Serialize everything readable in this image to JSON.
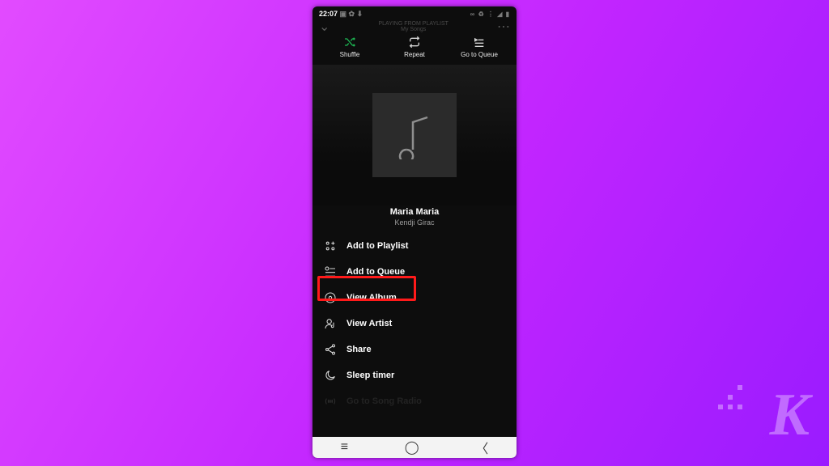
{
  "status": {
    "time": "22:07",
    "left_icons": "▣ ✿ ⬇",
    "right_icons": "∞ ♻ ⋮ ◢ ▮"
  },
  "header": {
    "subtitle": "PLAYING FROM PLAYLIST",
    "playlist": "My Songs"
  },
  "actions": {
    "shuffle": "Shuffle",
    "repeat": "Repeat",
    "queue": "Go to Queue"
  },
  "track": {
    "title": "Maria Maria",
    "artist": "Kendji Girac"
  },
  "menu": {
    "add_playlist": "Add to Playlist",
    "add_queue": "Add to Queue",
    "view_album": "View Album",
    "view_artist": "View Artist",
    "share": "Share",
    "sleep_timer": "Sleep timer",
    "song_radio": "Go to Song Radio"
  },
  "logo": "K"
}
